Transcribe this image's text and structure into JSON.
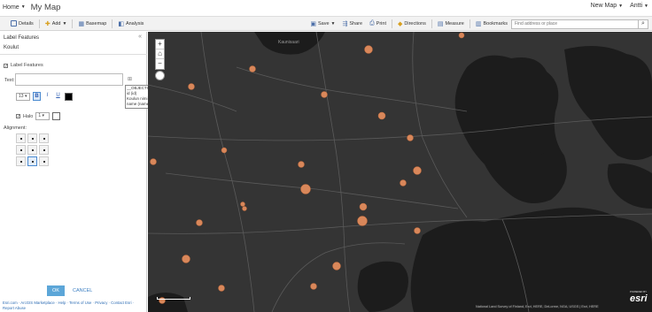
{
  "header": {
    "home_label": "Home",
    "map_title": "My Map",
    "new_map_label": "New Map",
    "user_name": "Antti"
  },
  "toolbar": {
    "details_label": "Details",
    "add_label": "Add",
    "basemap_label": "Basemap",
    "analysis_label": "Analysis",
    "save_label": "Save",
    "share_label": "Share",
    "print_label": "Print",
    "directions_label": "Directions",
    "measure_label": "Measure",
    "bookmarks_label": "Bookmarks",
    "search_placeholder": "Find address or place"
  },
  "panel": {
    "title": "Label Features",
    "layer_name": "Koulut",
    "label_features_checkbox": "Label Features",
    "label_features_checked": true,
    "text_label": "Text:",
    "text_value": "",
    "field_options": [
      "__OBJECTID (__OBJECTID)",
      "id (id)",
      "Koulun nimi (Koulun_nimi)",
      "name (name)"
    ],
    "font_size": "13",
    "halo_label": "Halo",
    "halo_size": "1",
    "alignment_label": "Alignment:",
    "ok_label": "OK",
    "cancel_label": "CANCEL",
    "footer_links": "Esri.com · ArcGIS Marketplace · Help · Terms of Use · Privacy · Contact Esri · Report Abuse"
  },
  "map": {
    "place_label": "Kaunisaari",
    "attribution": "National Land Survey of Finland, Esri, HERE, DeLorme, NGA, USGS | Esri, HERE",
    "powered_by": "POWERED BY",
    "esri_logo": "esri",
    "point_color": "#d9875a",
    "background_color": "#343434",
    "water_color": "#1a1a1a"
  }
}
